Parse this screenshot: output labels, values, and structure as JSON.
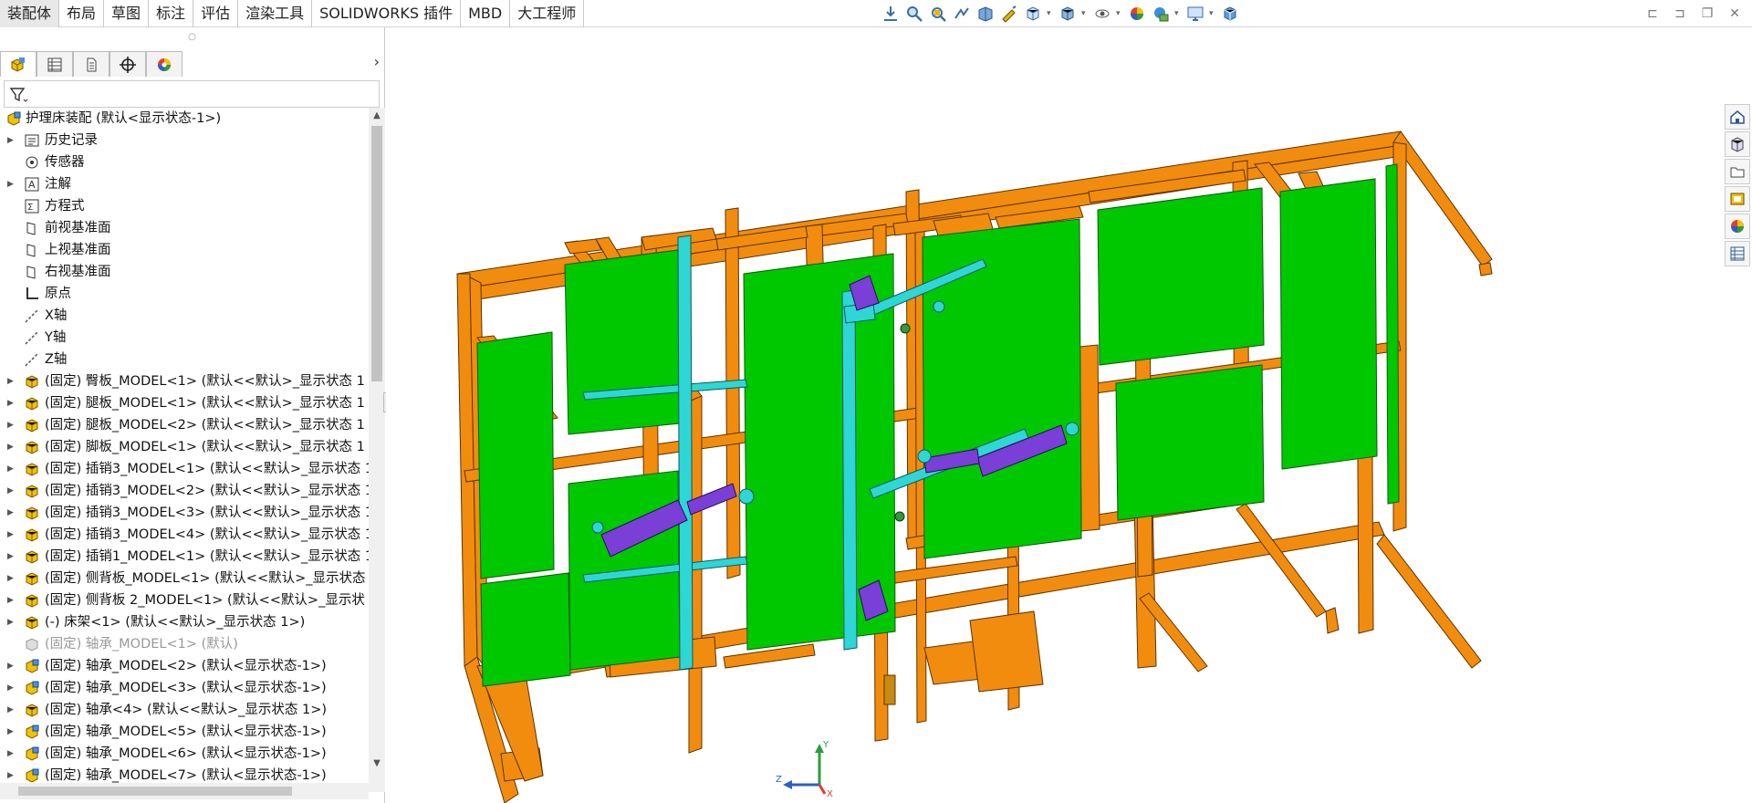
{
  "tabs": [
    "装配体",
    "布局",
    "草图",
    "标注",
    "评估",
    "渲染工具",
    "SOLIDWORKS 插件",
    "MBD",
    "大工程师"
  ],
  "active_tab": "装配体",
  "view_toolbar_icons": [
    "standard-views-icon",
    "zoom-to-fit-icon",
    "zoom-area-icon",
    "previous-view-icon",
    "section-view-icon",
    "dynamic-annotation-icon",
    "view-orientation-icon",
    "display-style-icon",
    "hide-show-icon",
    "edit-appearance-icon",
    "apply-scene-icon",
    "view-settings-icon",
    "display-pane-icon"
  ],
  "manager_tabs": [
    "featuremanager-tab",
    "propertymanager-tab",
    "configurationmanager-tab",
    "dimxpert-tab",
    "displaymanager-tab"
  ],
  "tree": {
    "root": "护理床装配 (默认<显示状态-1>)",
    "items": [
      {
        "label": "历史记录",
        "icon": "history-icon",
        "expandable": true
      },
      {
        "label": "传感器",
        "icon": "sensor-icon",
        "expandable": false
      },
      {
        "label": "注解",
        "icon": "annotation-icon",
        "expandable": true
      },
      {
        "label": "方程式",
        "icon": "equation-icon",
        "expandable": false
      },
      {
        "label": "前视基准面",
        "icon": "plane-icon",
        "expandable": false
      },
      {
        "label": "上视基准面",
        "icon": "plane-icon",
        "expandable": false
      },
      {
        "label": "右视基准面",
        "icon": "plane-icon",
        "expandable": false
      },
      {
        "label": "原点",
        "icon": "origin-icon",
        "expandable": false
      },
      {
        "label": "X轴",
        "icon": "axis-icon",
        "expandable": false
      },
      {
        "label": "Y轴",
        "icon": "axis-icon",
        "expandable": false
      },
      {
        "label": "Z轴",
        "icon": "axis-icon",
        "expandable": false
      },
      {
        "label": "(固定) 臀板_MODEL<1> (默认<<默认>_显示状态 1",
        "icon": "part-icon",
        "expandable": true
      },
      {
        "label": "(固定) 腿板_MODEL<1> (默认<<默认>_显示状态 1",
        "icon": "part-icon",
        "expandable": true
      },
      {
        "label": "(固定) 腿板_MODEL<2> (默认<<默认>_显示状态 1",
        "icon": "part-icon",
        "expandable": true
      },
      {
        "label": "(固定) 脚板_MODEL<1> (默认<<默认>_显示状态 1",
        "icon": "part-icon",
        "expandable": true
      },
      {
        "label": "(固定) 插销3_MODEL<1> (默认<<默认>_显示状态 1",
        "icon": "part-icon",
        "expandable": true
      },
      {
        "label": "(固定) 插销3_MODEL<2> (默认<<默认>_显示状态 1",
        "icon": "part-icon",
        "expandable": true
      },
      {
        "label": "(固定) 插销3_MODEL<3> (默认<<默认>_显示状态 1",
        "icon": "part-icon",
        "expandable": true
      },
      {
        "label": "(固定) 插销3_MODEL<4> (默认<<默认>_显示状态 1",
        "icon": "part-icon",
        "expandable": true
      },
      {
        "label": "(固定) 插销1_MODEL<1> (默认<<默认>_显示状态 1",
        "icon": "part-icon",
        "expandable": true
      },
      {
        "label": "(固定) 侧背板_MODEL<1> (默认<<默认>_显示状态",
        "icon": "part-icon",
        "expandable": true
      },
      {
        "label": "(固定) 侧背板 2_MODEL<1> (默认<<默认>_显示状",
        "icon": "part-icon",
        "expandable": true
      },
      {
        "label": "(-) 床架<1> (默认<<默认>_显示状态 1>)",
        "icon": "part-icon",
        "expandable": true
      },
      {
        "label": "(固定) 轴承_MODEL<1> (默认)",
        "icon": "part-suppressed-icon",
        "expandable": false,
        "dim": true
      },
      {
        "label": "(固定) 轴承_MODEL<2> (默认<显示状态-1>)",
        "icon": "subassembly-icon",
        "expandable": true
      },
      {
        "label": "(固定) 轴承_MODEL<3> (默认<显示状态-1>)",
        "icon": "subassembly-icon",
        "expandable": true
      },
      {
        "label": "(固定) 轴承<4> (默认<<默认>_显示状态 1>)",
        "icon": "part-icon",
        "expandable": true
      },
      {
        "label": "(固定) 轴承_MODEL<5> (默认<显示状态-1>)",
        "icon": "subassembly-icon",
        "expandable": true
      },
      {
        "label": "(固定) 轴承_MODEL<6> (默认<显示状态-1>)",
        "icon": "subassembly-icon",
        "expandable": true
      },
      {
        "label": "(固定) 轴承_MODEL<7> (默认<显示状态-1>)",
        "icon": "subassembly-icon",
        "expandable": true
      }
    ]
  },
  "task_pane_icons": [
    "solidworks-resources-icon",
    "design-library-icon",
    "file-explorer-icon",
    "view-palette-icon",
    "appearances-icon",
    "custom-properties-icon"
  ],
  "triad_labels": {
    "y": "Y",
    "z": "Z",
    "x": "X"
  },
  "colors": {
    "frame": "#f28c0f",
    "panel": "#00c800",
    "cylinder": "#7a3fd6",
    "rod": "#2fd6d6",
    "gear": "#6b35c7"
  }
}
